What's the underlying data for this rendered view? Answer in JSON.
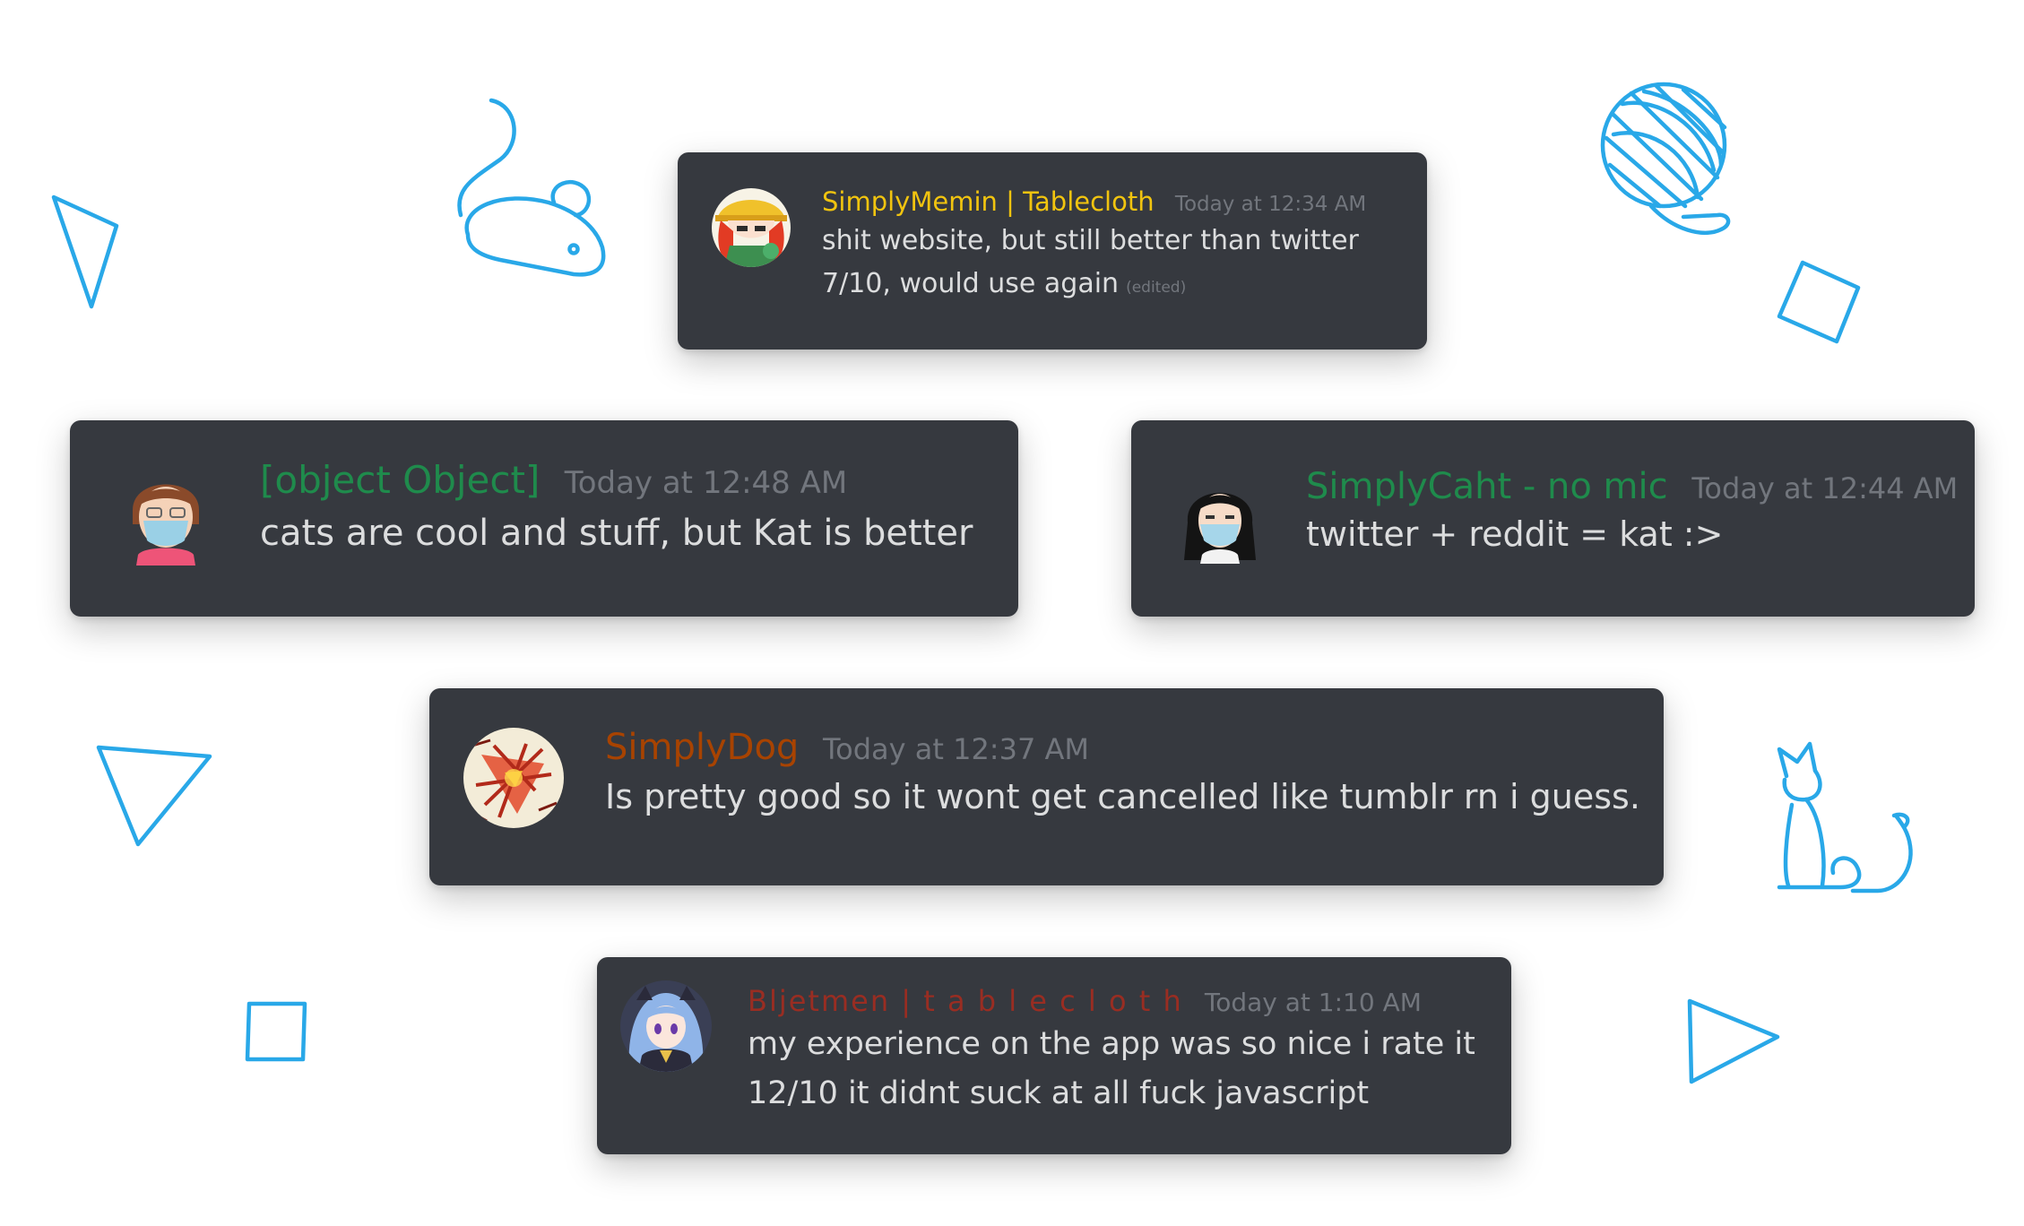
{
  "colors": {
    "background": "#ffffff",
    "card": "#36393f",
    "message_text": "#dcddde",
    "timestamp": "#72767d",
    "decoration": "#29a8e8"
  },
  "decorations": [
    "mouse-doodle-icon",
    "yarn-ball-icon",
    "cat-doodle-icon",
    "triangle-outline-icon",
    "square-outline-icon",
    "play-triangle-icon"
  ],
  "messages": [
    {
      "avatar": "anime-girl-hat-avatar",
      "username": "SimplyMemin | Tablecloth",
      "username_color": "#f1c40f",
      "timestamp": "Today at 12:34 AM",
      "lines": [
        "shit website, but still better than twitter",
        "7/10, would use again"
      ],
      "edited": "(edited)"
    },
    {
      "avatar": "mii-boy-mask-avatar",
      "username": "[object Object]",
      "username_color": "#1f8b4c",
      "timestamp": "Today at 12:48 AM",
      "lines": [
        "cats are cool and stuff, but Kat is better"
      ]
    },
    {
      "avatar": "mii-girl-mask-avatar",
      "username": "SimplyCaht - no mic",
      "username_color": "#1f8b4c",
      "timestamp": "Today at 12:44 AM",
      "lines": [
        "twitter + reddit = kat :>"
      ]
    },
    {
      "avatar": "abstract-art-avatar",
      "username": "SimplyDog",
      "username_color": "#a84300",
      "timestamp": "Today at 12:37 AM",
      "lines": [
        "Is pretty good so it wont get cancelled like tumblr rn i guess."
      ]
    },
    {
      "avatar": "anime-blue-hair-avatar",
      "username": "Bljetmen | t a b l e c l o t h",
      "username_color": "#992d22",
      "timestamp": "Today at 1:10 AM",
      "lines": [
        "my experience on the app was so nice i rate it",
        "12/10 it didnt suck at all fuck javascript"
      ]
    }
  ]
}
